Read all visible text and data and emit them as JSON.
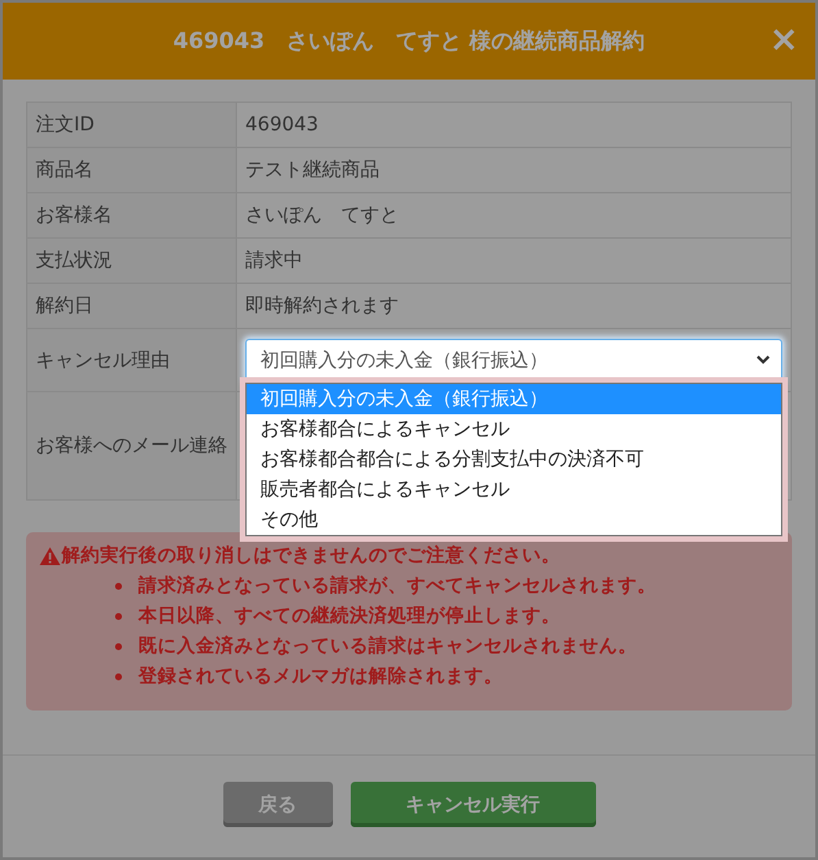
{
  "window": {
    "title": "469043　さいぽん　てすと 様の継続商品解約",
    "close": "×"
  },
  "fields": [
    {
      "kind": "text",
      "label": "注文ID",
      "value": "469043"
    },
    {
      "kind": "text",
      "label": "商品名",
      "value": "テスト継続商品"
    },
    {
      "kind": "text",
      "label": "お客様名",
      "value": "さいぽん　てすと"
    },
    {
      "kind": "text",
      "label": "支払状況",
      "value": "請求中"
    },
    {
      "kind": "text",
      "label": "解約日",
      "value": "即時解約されます"
    },
    {
      "kind": "select",
      "label": "キャンセル理由",
      "value": "初回購入分の未入金（銀行振込）",
      "expanded": true,
      "options": [
        {
          "label": "初回購入分の未入金（銀行振込）",
          "selected": true
        },
        {
          "label": "お客様都合によるキャンセル",
          "selected": false
        },
        {
          "label": "お客様都合都合による分割支払中の決済不可",
          "selected": false
        },
        {
          "label": "販売者都合によるキャンセル",
          "selected": false
        },
        {
          "label": "その他",
          "selected": false
        }
      ]
    },
    {
      "kind": "blank",
      "label": "お客様へのメール連絡"
    }
  ],
  "alert": {
    "title": "解約実行後の取り消しはできませんのでご注意ください。",
    "items": [
      "請求済みとなっている請求が、すべてキャンセルされます。",
      "本日以降、すべての継続決済処理が停止します。",
      "既に入金済みとなっている請求はキャンセルされません。",
      "登録されているメルマガは解除されます。"
    ]
  },
  "buttons": [
    {
      "kind": "back",
      "label": "戻る"
    },
    {
      "kind": "primary",
      "label": "キャンセル実行"
    }
  ]
}
